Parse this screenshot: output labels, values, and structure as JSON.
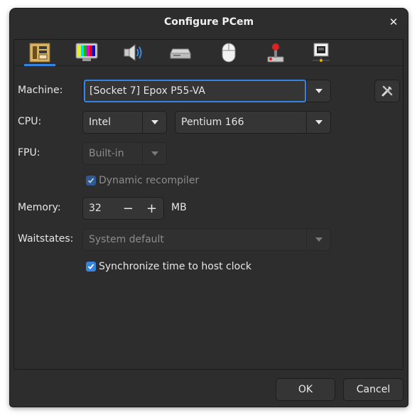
{
  "window": {
    "title": "Configure PCem"
  },
  "tabs": [
    {
      "icon": "motherboard-icon",
      "active": true
    },
    {
      "icon": "monitor-icon"
    },
    {
      "icon": "speaker-icon"
    },
    {
      "icon": "drive-icon"
    },
    {
      "icon": "mouse-icon"
    },
    {
      "icon": "joystick-icon"
    },
    {
      "icon": "network-icon"
    }
  ],
  "machine": {
    "label": "Machine:",
    "value": "[Socket 7] Epox P55-VA",
    "config_icon": "tools-icon"
  },
  "cpu": {
    "label": "CPU:",
    "vendor": "Intel",
    "model": "Pentium 166"
  },
  "fpu": {
    "label": "FPU:",
    "value": "Built-in"
  },
  "dynarec": {
    "label": "Dynamic recompiler",
    "checked": true
  },
  "memory": {
    "label": "Memory:",
    "value": "32",
    "unit": "MB",
    "minus": "−",
    "plus": "+"
  },
  "waitstates": {
    "label": "Waitstates:",
    "value": "System default"
  },
  "sync_time": {
    "label": "Synchronize time to host clock",
    "checked": true
  },
  "buttons": {
    "ok": "OK",
    "cancel": "Cancel"
  },
  "colors": {
    "accent": "#3584e4",
    "window_bg": "#2d2d2d",
    "field_bg": "#353535"
  }
}
